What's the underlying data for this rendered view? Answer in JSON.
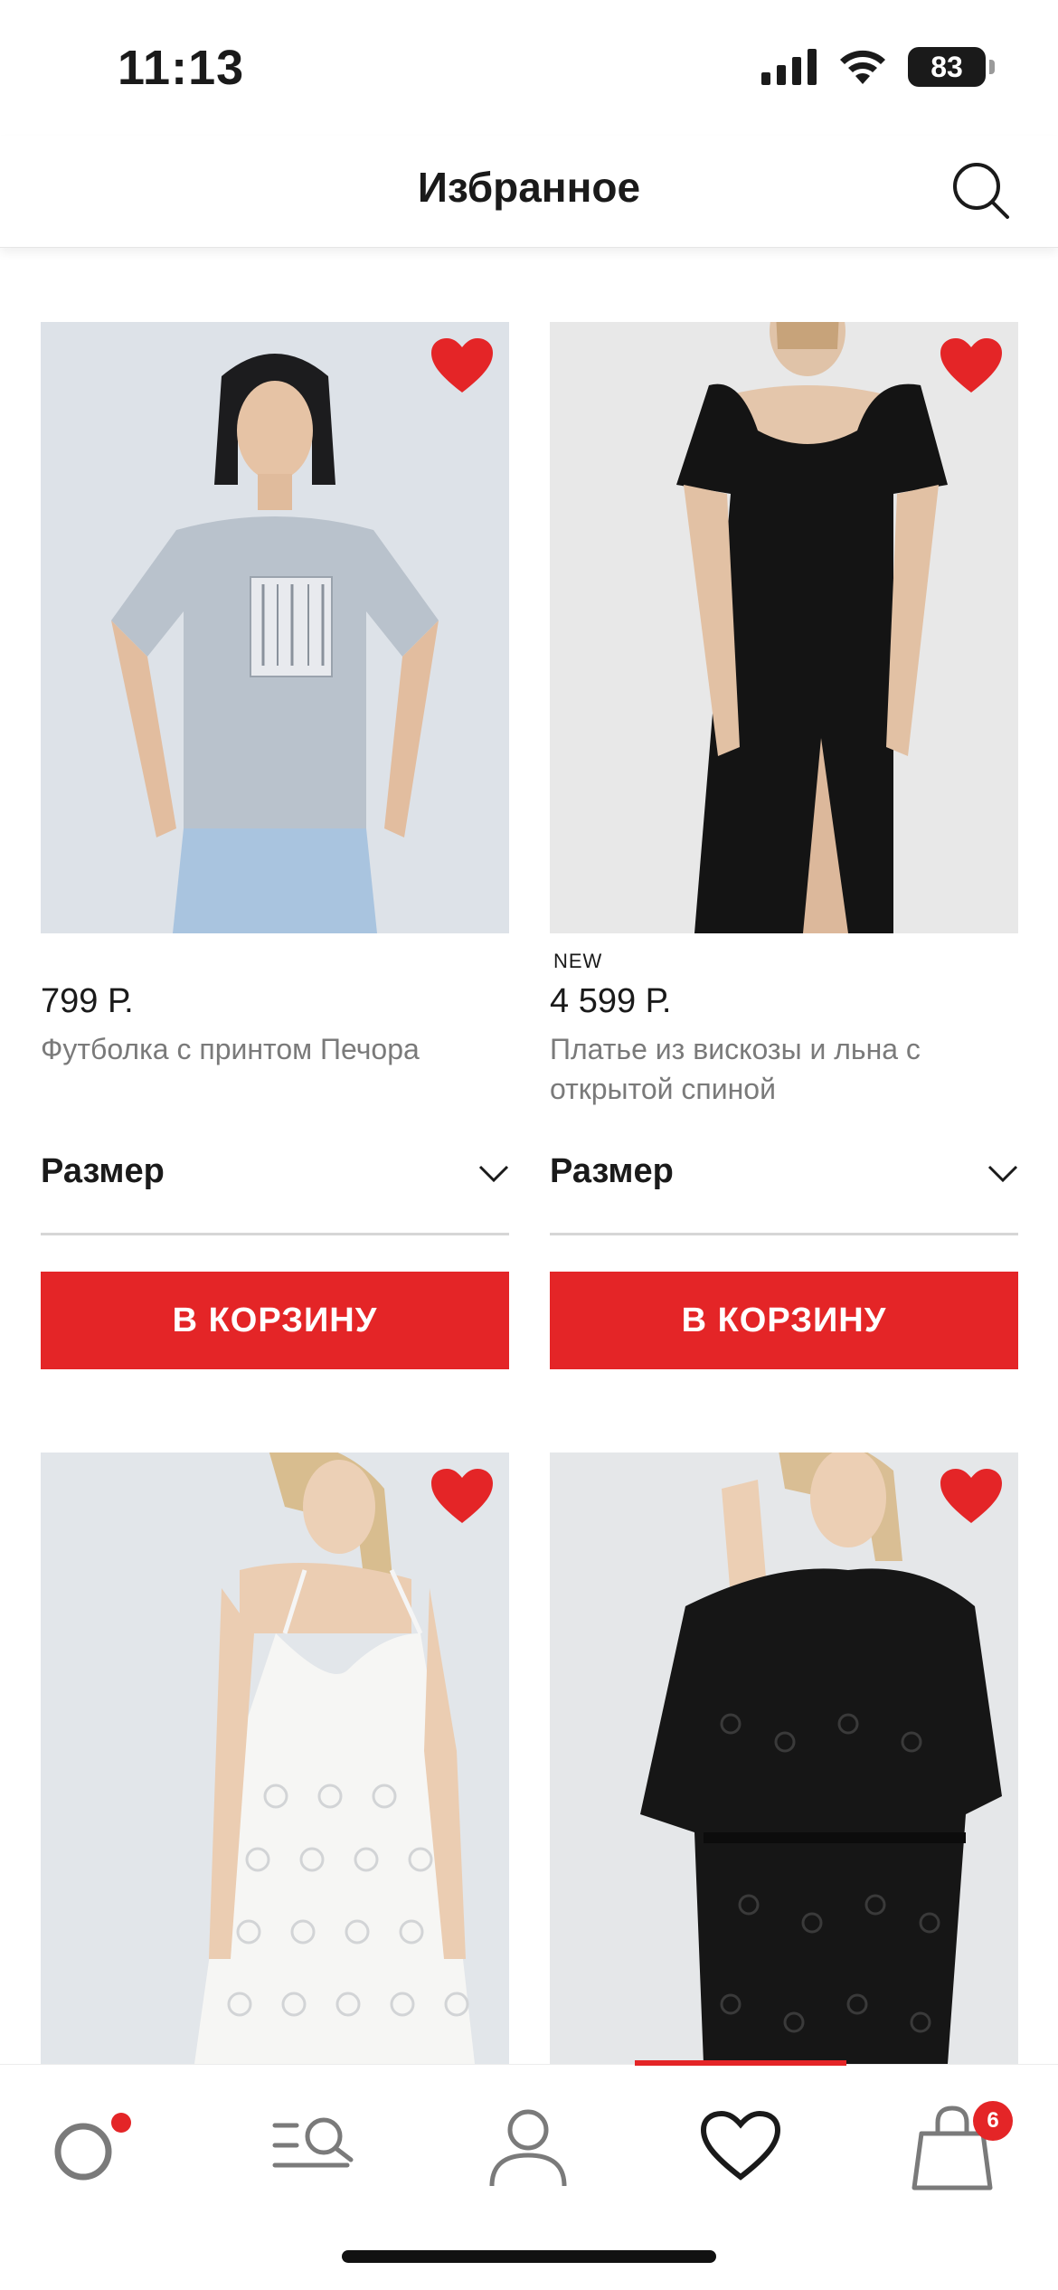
{
  "status_bar": {
    "time": "11:13",
    "battery": "83"
  },
  "header": {
    "title": "Избранное"
  },
  "products": [
    {
      "price": "799 Р.",
      "name": "Футболка с принтом Печора",
      "badge": "",
      "size_label": "Размер",
      "cart_label": "В КОРЗИНУ",
      "favorite": true
    },
    {
      "price": "4 599 Р.",
      "name": "Платье из вискозы и льна с открытой спиной",
      "badge": "NEW",
      "size_label": "Размер",
      "cart_label": "В КОРЗИНУ",
      "favorite": true
    },
    {
      "price": "",
      "name": "",
      "badge": "",
      "favorite": true
    },
    {
      "price": "",
      "name": "",
      "badge": "",
      "favorite": true
    }
  ],
  "tabbar": {
    "active": "favorites",
    "cart_count": "6"
  },
  "colors": {
    "accent": "#e42527",
    "text": "#1a1a1a",
    "muted": "#7a7a7a"
  }
}
